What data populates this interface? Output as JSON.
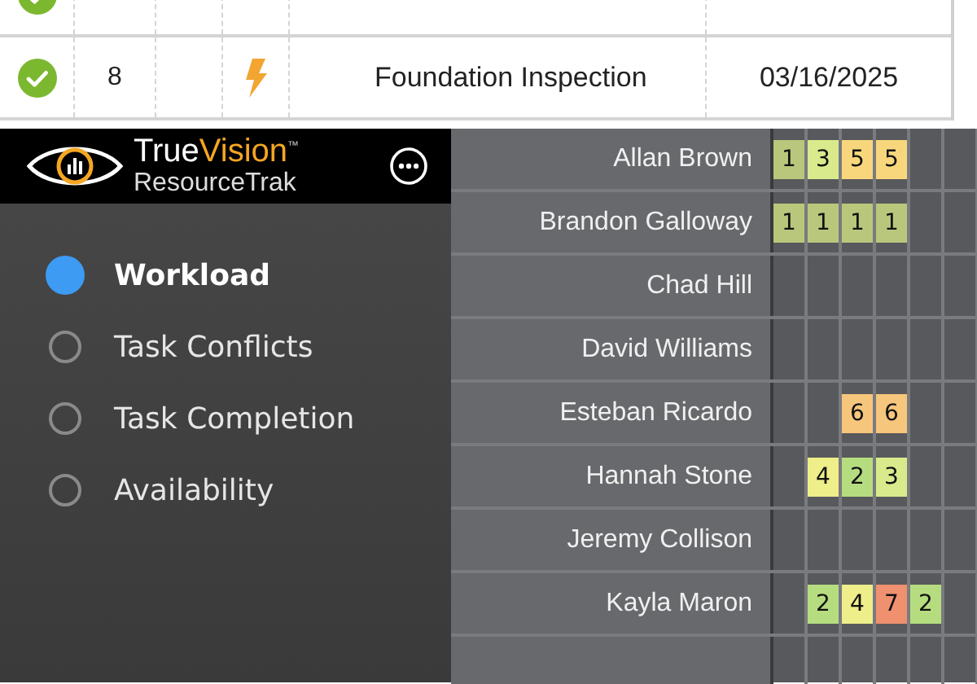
{
  "task_table": {
    "rows": [
      {
        "done": true
      },
      {
        "done": true,
        "number": "8",
        "flagged": true,
        "task": "Foundation Inspection",
        "date": "03/16/2025"
      }
    ]
  },
  "sidebar": {
    "brand_true": "True",
    "brand_vision": "Vision",
    "brand_tm": "™",
    "brand_sub": "ResourceTrak",
    "items": [
      {
        "label": "Workload",
        "selected": true
      },
      {
        "label": "Task Conflicts",
        "selected": false
      },
      {
        "label": "Task Completion",
        "selected": false
      },
      {
        "label": "Availability",
        "selected": false
      }
    ]
  },
  "workload": {
    "people": [
      {
        "name": "Allan Brown",
        "cells": [
          {
            "value": "1",
            "color": "#b9c77c"
          },
          {
            "value": "3",
            "color": "#d9ea8c"
          },
          {
            "value": "5",
            "color": "#f8d77c"
          },
          {
            "value": "5",
            "color": "#f8d77c"
          },
          null,
          null
        ]
      },
      {
        "name": "Brandon Galloway",
        "cells": [
          {
            "value": "1",
            "color": "#b9c77c"
          },
          {
            "value": "1",
            "color": "#b9c77c"
          },
          {
            "value": "1",
            "color": "#b9c77c"
          },
          {
            "value": "1",
            "color": "#b9c77c"
          },
          null,
          null
        ]
      },
      {
        "name": "Chad Hill",
        "cells": [
          null,
          null,
          null,
          null,
          null,
          null
        ]
      },
      {
        "name": "David Williams",
        "cells": [
          null,
          null,
          null,
          null,
          null,
          null
        ]
      },
      {
        "name": "Esteban Ricardo",
        "cells": [
          null,
          null,
          {
            "value": "6",
            "color": "#f6c67c"
          },
          {
            "value": "6",
            "color": "#f6c67c"
          },
          null,
          null
        ]
      },
      {
        "name": "Hannah Stone",
        "cells": [
          null,
          {
            "value": "4",
            "color": "#eeee8a"
          },
          {
            "value": "2",
            "color": "#b6dc80"
          },
          {
            "value": "3",
            "color": "#d9ea8c"
          },
          null,
          null
        ]
      },
      {
        "name": "Jeremy Collison",
        "cells": [
          null,
          null,
          null,
          null,
          null,
          null
        ]
      },
      {
        "name": "Kayla Maron",
        "cells": [
          null,
          {
            "value": "2",
            "color": "#b6dc80"
          },
          {
            "value": "4",
            "color": "#eeee8a"
          },
          {
            "value": "7",
            "color": "#ef906f"
          },
          {
            "value": "2",
            "color": "#b6dc80"
          },
          null
        ]
      },
      {
        "cells": [
          null,
          null,
          null,
          null,
          null,
          null
        ]
      }
    ]
  }
}
